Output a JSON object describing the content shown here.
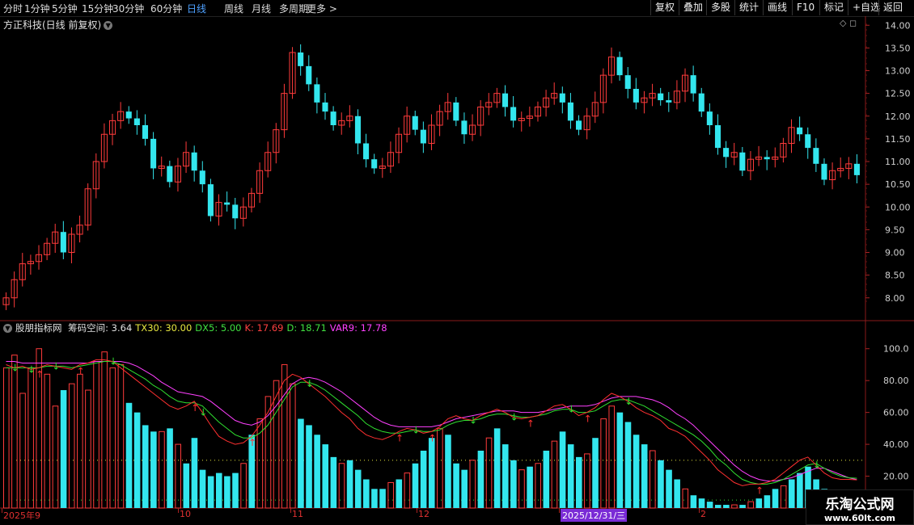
{
  "toolbar": {
    "periods": [
      "分时",
      "1分钟",
      "5分钟",
      "15分钟",
      "30分钟",
      "60分钟",
      "日线",
      "周线",
      "月线",
      "多周期",
      "更多 >"
    ],
    "active_index": 6,
    "buttons": [
      "复权",
      "叠加",
      "多股",
      "统计",
      "画线",
      "F10",
      "标记",
      "+自选",
      "返回"
    ]
  },
  "stock": {
    "title": "方正科技(日线 前复权)"
  },
  "price_axis": {
    "labels": [
      "14.00",
      "13.50",
      "13.00",
      "12.50",
      "12.00",
      "11.50",
      "11.00",
      "10.50",
      "10.00",
      "9.50",
      "9.00",
      "8.50",
      "8.00"
    ]
  },
  "indicator": {
    "name": "股朋指标网",
    "fields": [
      {
        "text": "筹码空间: 3.64",
        "color": "#e0e0e0"
      },
      {
        "text": "TX30: 30.00",
        "color": "#e8e840"
      },
      {
        "text": "DX5: 5.00",
        "color": "#40e040"
      },
      {
        "text": "K: 17.69",
        "color": "#ff4040"
      },
      {
        "text": "D: 18.71",
        "color": "#40e040"
      },
      {
        "text": "VAR9: 17.78",
        "color": "#ff40ff"
      }
    ],
    "axis_labels": [
      "100.0",
      "80.00",
      "60.00",
      "40.00",
      "20.00"
    ]
  },
  "dates": [
    "2025年9",
    "10",
    "11",
    "12",
    "2025/12/31/三",
    "2"
  ],
  "watermark": {
    "title": "乐淘公式网",
    "url": "www.60lt.com"
  },
  "colors": {
    "up": "#ff3b3b",
    "down": "#33e6ee",
    "k": "#ff3030",
    "d": "#30e030",
    "var9": "#ff40ff",
    "tx30": "#e8e840"
  },
  "chart_data": {
    "type": "candlestick",
    "ylim": [
      7.8,
      14.2
    ],
    "close": [
      8.0,
      8.4,
      8.75,
      8.8,
      8.95,
      9.2,
      9.45,
      9.0,
      9.4,
      9.6,
      10.4,
      11.0,
      11.6,
      11.9,
      12.1,
      11.95,
      11.8,
      11.5,
      10.85,
      10.9,
      10.55,
      10.9,
      11.2,
      10.8,
      10.5,
      9.8,
      10.1,
      10.05,
      9.75,
      10.0,
      10.3,
      10.8,
      11.2,
      11.7,
      12.5,
      13.4,
      13.1,
      12.7,
      12.3,
      12.1,
      11.8,
      11.9,
      12.0,
      11.4,
      11.05,
      10.85,
      10.9,
      11.2,
      11.6,
      12.0,
      11.7,
      11.4,
      11.8,
      12.1,
      12.3,
      11.9,
      11.6,
      11.8,
      12.2,
      12.3,
      12.5,
      12.2,
      11.9,
      11.95,
      12.0,
      12.2,
      12.4,
      12.5,
      12.3,
      11.9,
      11.7,
      12.0,
      12.3,
      12.9,
      13.3,
      12.9,
      12.6,
      12.3,
      12.4,
      12.5,
      12.35,
      12.3,
      12.55,
      12.9,
      12.5,
      12.1,
      11.8,
      11.3,
      11.1,
      11.2,
      10.8,
      11.05,
      11.1,
      11.05,
      11.1,
      11.4,
      11.75,
      11.6,
      11.3,
      10.95,
      10.6,
      10.8,
      10.85,
      10.95,
      10.7
    ],
    "k": [
      90,
      88,
      89,
      87,
      88,
      90,
      89,
      88,
      87,
      90,
      91,
      93,
      93,
      92,
      88,
      84,
      80,
      76,
      72,
      68,
      64,
      62,
      64,
      67,
      60,
      52,
      45,
      42,
      40,
      41,
      45,
      52,
      60,
      70,
      80,
      84,
      82,
      78,
      74,
      70,
      65,
      60,
      56,
      50,
      46,
      44,
      43,
      45,
      48,
      50,
      49,
      47,
      48,
      51,
      56,
      58,
      56,
      55,
      58,
      60,
      62,
      60,
      57,
      56,
      57,
      58,
      61,
      64,
      65,
      62,
      58,
      60,
      63,
      68,
      72,
      70,
      67,
      63,
      60,
      58,
      55,
      50,
      48,
      45,
      40,
      35,
      30,
      24,
      20,
      16,
      14,
      15,
      15,
      16,
      18,
      22,
      26,
      30,
      32,
      27,
      22,
      19,
      18,
      18,
      17.69
    ],
    "d": [
      88,
      88,
      88,
      88,
      88,
      89,
      89,
      89,
      88,
      89,
      90,
      91,
      92,
      92,
      90,
      87,
      84,
      81,
      77,
      74,
      70,
      67,
      66,
      66,
      64,
      59,
      54,
      50,
      46,
      44,
      44,
      47,
      52,
      60,
      68,
      76,
      79,
      79,
      77,
      74,
      70,
      66,
      62,
      58,
      53,
      50,
      48,
      47,
      47,
      48,
      49,
      48,
      48,
      49,
      52,
      54,
      55,
      55,
      56,
      58,
      59,
      59,
      58,
      57,
      57,
      58,
      59,
      61,
      62,
      62,
      60,
      60,
      61,
      64,
      67,
      68,
      68,
      66,
      64,
      61,
      58,
      55,
      52,
      49,
      46,
      42,
      37,
      31,
      27,
      22,
      18,
      16,
      15,
      15,
      16,
      18,
      21,
      24,
      27,
      28,
      25,
      22,
      20,
      19,
      18.71
    ],
    "var9": [
      92,
      92,
      91,
      91,
      91,
      91,
      91,
      91,
      91,
      91,
      91,
      92,
      92,
      92,
      92,
      91,
      89,
      86,
      83,
      79,
      76,
      73,
      72,
      71,
      70,
      67,
      63,
      59,
      55,
      53,
      52,
      54,
      58,
      64,
      71,
      78,
      81,
      82,
      81,
      79,
      76,
      73,
      69,
      65,
      61,
      57,
      54,
      52,
      51,
      51,
      51,
      51,
      51,
      52,
      54,
      56,
      57,
      58,
      59,
      60,
      61,
      61,
      61,
      60,
      60,
      60,
      61,
      62,
      63,
      64,
      64,
      64,
      65,
      67,
      69,
      70,
      70,
      70,
      69,
      68,
      66,
      63,
      59,
      56,
      52,
      47,
      42,
      37,
      32,
      27,
      23,
      20,
      18,
      17,
      17,
      18,
      19,
      21,
      23,
      25,
      25,
      23,
      21,
      19,
      17.78
    ],
    "histogram": [
      88,
      96,
      72,
      88,
      100,
      84,
      64,
      74,
      78,
      84,
      74,
      92,
      98,
      88,
      90,
      66,
      60,
      52,
      48,
      48,
      50,
      40,
      28,
      44,
      24,
      20,
      22,
      20,
      22,
      28,
      46,
      56,
      70,
      80,
      90,
      78,
      56,
      52,
      46,
      40,
      32,
      28,
      30,
      24,
      18,
      12,
      12,
      16,
      18,
      22,
      28,
      36,
      44,
      50,
      46,
      28,
      24,
      30,
      36,
      44,
      50,
      40,
      30,
      24,
      26,
      28,
      36,
      42,
      48,
      40,
      32,
      34,
      44,
      56,
      64,
      60,
      54,
      46,
      40,
      36,
      30,
      24,
      18,
      12,
      8,
      6,
      4,
      2,
      2,
      2,
      2,
      4,
      6,
      8,
      12,
      14,
      18,
      22,
      26,
      18,
      12,
      8,
      6,
      6,
      6
    ]
  }
}
